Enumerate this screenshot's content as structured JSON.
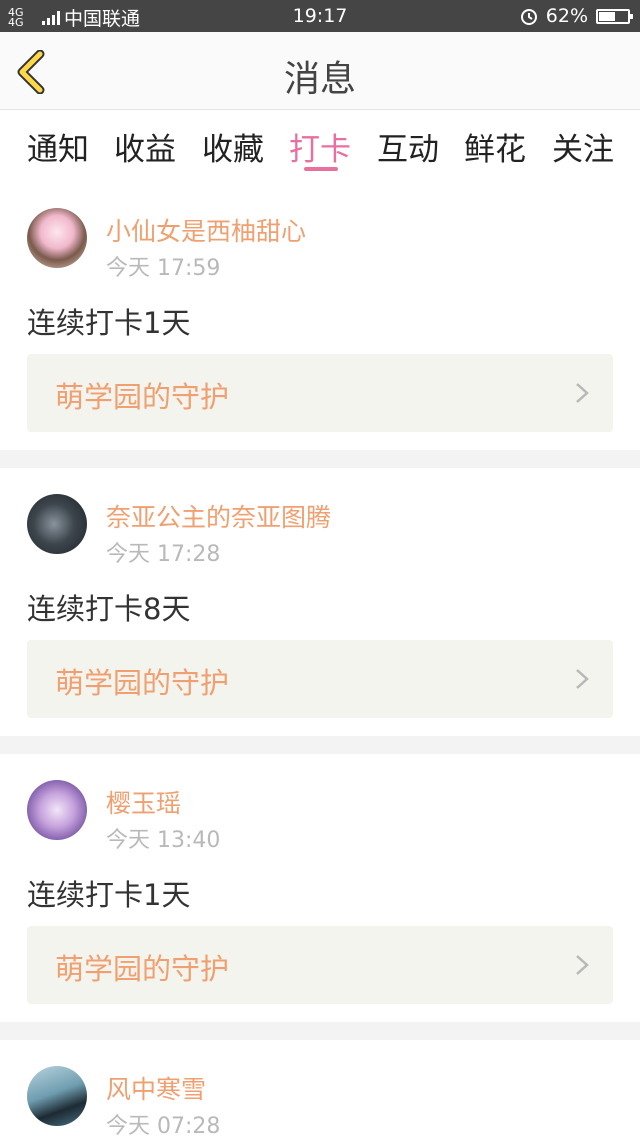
{
  "status_bar": {
    "network": "4G 4G",
    "carrier": "中国联通",
    "time": "19:17",
    "battery": "62%",
    "battery_level": 0.62
  },
  "header": {
    "title": "消息"
  },
  "tabs": [
    {
      "label": "通知"
    },
    {
      "label": "收益"
    },
    {
      "label": "收藏"
    },
    {
      "label": "打卡",
      "active": true
    },
    {
      "label": "互动"
    },
    {
      "label": "鲜花"
    },
    {
      "label": "关注"
    }
  ],
  "feed": [
    {
      "username": "小仙女是西柚甜心",
      "time": "今天 17:59",
      "message": "连续打卡1天",
      "link": "萌学园的守护"
    },
    {
      "username": "奈亚公主的奈亚图腾",
      "time": "今天 17:28",
      "message": "连续打卡8天",
      "link": "萌学园的守护"
    },
    {
      "username": "樱玉瑶",
      "time": "今天 13:40",
      "message": "连续打卡1天",
      "link": "萌学园的守护"
    },
    {
      "username": "风中寒雪",
      "time": "今天 07:28"
    }
  ],
  "colors": {
    "accent": "#e870a0",
    "username": "#f0a070",
    "status_bar": "#454545"
  }
}
